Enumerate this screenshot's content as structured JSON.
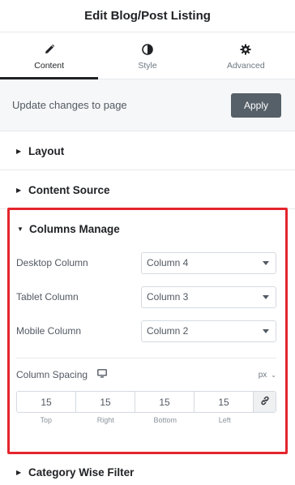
{
  "header": {
    "title": "Edit Blog/Post Listing"
  },
  "tabs": [
    {
      "label": "Content",
      "icon": "pencil-icon",
      "active": true
    },
    {
      "label": "Style",
      "icon": "half-circle-icon",
      "active": false
    },
    {
      "label": "Advanced",
      "icon": "gear-icon",
      "active": false
    }
  ],
  "update": {
    "text": "Update changes to page",
    "button": "Apply"
  },
  "sections": {
    "layout": "Layout",
    "content_source": "Content Source",
    "columns_manage": "Columns Manage",
    "category_filter": "Category Wise Filter"
  },
  "columns": {
    "desktop": {
      "label": "Desktop Column",
      "value": "Column 4"
    },
    "tablet": {
      "label": "Tablet Column",
      "value": "Column 3"
    },
    "mobile": {
      "label": "Mobile Column",
      "value": "Column 2"
    }
  },
  "spacing": {
    "label": "Column Spacing",
    "device_icon": "desktop-icon",
    "unit": "px",
    "top": "15",
    "right": "15",
    "bottom": "15",
    "left": "15",
    "labels": {
      "top": "Top",
      "right": "Right",
      "bottom": "Bottom",
      "left": "Left"
    }
  },
  "colors": {
    "highlight": "#e4252d",
    "apply_bg": "#556068"
  }
}
